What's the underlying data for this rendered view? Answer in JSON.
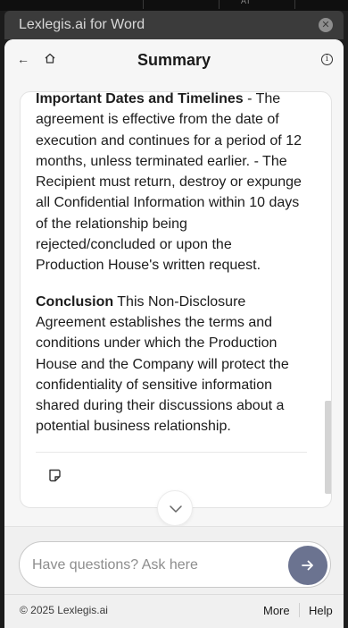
{
  "window": {
    "title": "Lexlegis.ai for Word",
    "close_glyph": "✕",
    "top_strip_text": "AI"
  },
  "header": {
    "back_glyph": "←",
    "home_icon": "home-icon",
    "title": "Summary",
    "info_glyph": "i"
  },
  "summary": {
    "sections": [
      {
        "heading": "Important Dates and Timelines",
        "separator": " - ",
        "text": "The agreement is effective from the date of execution and continues for a period of 12 months, unless terminated earlier. - The Recipient must return, destroy or expunge all Confidential Information within 10 days of the relationship being rejected/concluded or upon the Production House's written request."
      },
      {
        "heading": "Conclusion",
        "separator": " ",
        "text": "This Non-Disclosure Agreement establishes the terms and conditions under which the Production House and the Company will protect the confidentiality of sensitive information shared during their discussions about a potential business relationship."
      }
    ],
    "copy_icon": "copy-icon",
    "scroll_position": 0.82
  },
  "chat": {
    "placeholder": "Have questions? Ask here",
    "value": "",
    "send_icon": "arrow-right-icon"
  },
  "footer": {
    "copyright": "© 2025 Lexlegis.ai",
    "more": "More",
    "help": "Help"
  },
  "colors": {
    "send_button": "#6b7390",
    "pane_background": "#f6f6f6",
    "titlebar": "#3b3b3b"
  }
}
